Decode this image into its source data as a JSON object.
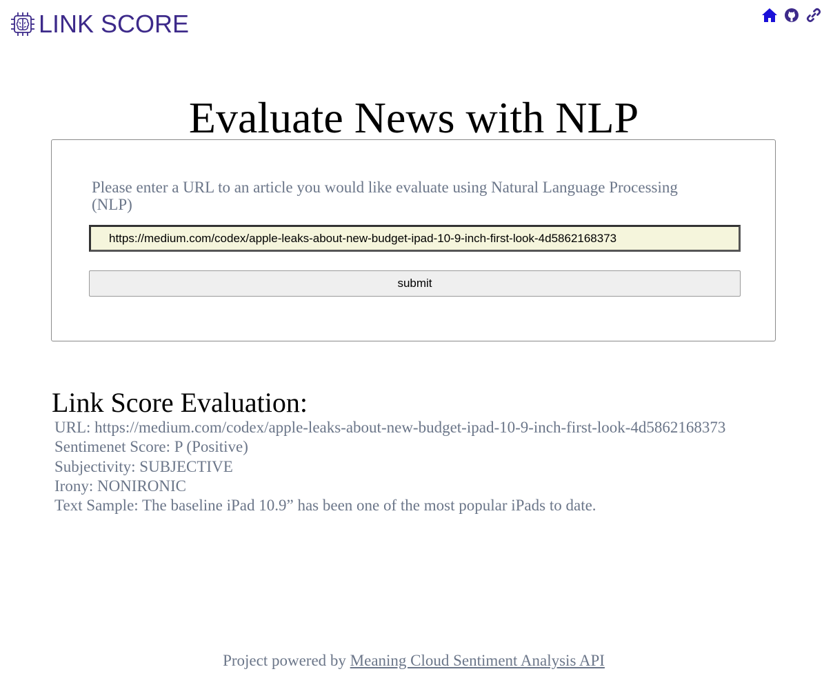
{
  "header": {
    "logo_text": "LINK SCORE",
    "nav_icons": [
      "home-icon",
      "github-icon",
      "link-icon"
    ],
    "brand_color": "#3d2a8a",
    "nav_icon_color": "#1a10d8"
  },
  "main": {
    "title": "Evaluate News with NLP",
    "form": {
      "label": "Please enter a URL to an article you would like evaluate using Natural Language Processing (NLP)",
      "url_value": "https://medium.com/codex/apple-leaks-about-new-budget-ipad-10-9-inch-first-look-4d5862168373",
      "submit_label": "submit"
    }
  },
  "results": {
    "title": "Link Score Evaluation:",
    "url": "URL: https://medium.com/codex/apple-leaks-about-new-budget-ipad-10-9-inch-first-look-4d5862168373",
    "sentiment": "Sentimenet Score: P (Positive)",
    "subjectivity": "Subjectivity: SUBJECTIVE",
    "irony": "Irony: NONIRONIC",
    "text_sample": "Text Sample: The baseline iPad 10.9” has been one of the most popular iPads to date."
  },
  "footer": {
    "prefix": "Project powered by ",
    "link_text": "Meaning Cloud Sentiment Analysis API"
  }
}
